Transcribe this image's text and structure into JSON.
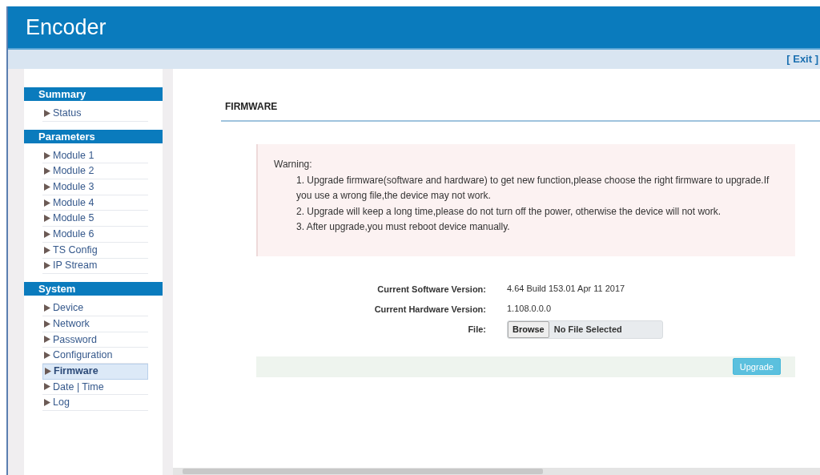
{
  "header": {
    "title": "Encoder"
  },
  "topbar": {
    "exit_link": "[ Exit ]"
  },
  "sidebar": {
    "sections": [
      {
        "title": "Summary",
        "items": [
          {
            "label": "Status",
            "selected": false
          }
        ]
      },
      {
        "title": "Parameters",
        "items": [
          {
            "label": "Module 1",
            "selected": false
          },
          {
            "label": "Module 2",
            "selected": false
          },
          {
            "label": "Module 3",
            "selected": false
          },
          {
            "label": "Module 4",
            "selected": false
          },
          {
            "label": "Module 5",
            "selected": false
          },
          {
            "label": "Module 6",
            "selected": false
          },
          {
            "label": "TS Config",
            "selected": false
          },
          {
            "label": "IP Stream",
            "selected": false
          }
        ]
      },
      {
        "title": "System",
        "items": [
          {
            "label": "Device",
            "selected": false
          },
          {
            "label": "Network",
            "selected": false
          },
          {
            "label": "Password",
            "selected": false
          },
          {
            "label": "Configuration",
            "selected": false
          },
          {
            "label": "Firmware",
            "selected": true
          },
          {
            "label": "Date | Time",
            "selected": false
          },
          {
            "label": "Log",
            "selected": false
          }
        ]
      }
    ]
  },
  "page": {
    "title": "FIRMWARE",
    "warning": {
      "heading": "Warning:",
      "lines": [
        "1. Upgrade firmware(software and hardware) to get new function,please choose the right firmware to upgrade.If you use a wrong file,the device may not work.",
        "2. Upgrade will keep a long time,please do not turn off the power, otherwise the device will not work.",
        "3. After upgrade,you must reboot device manually."
      ]
    },
    "fields": [
      {
        "kind": "text",
        "label": "Current Software Version:",
        "value": "4.64 Build 153.01 Apr 11 2017"
      },
      {
        "kind": "text",
        "label": "Current Hardware Version:",
        "value": "1.108.0.0.0"
      },
      {
        "kind": "file",
        "label": "File:",
        "button": "Browse",
        "value": "No File Selected"
      }
    ],
    "upgrade_button": "Upgrade"
  }
}
